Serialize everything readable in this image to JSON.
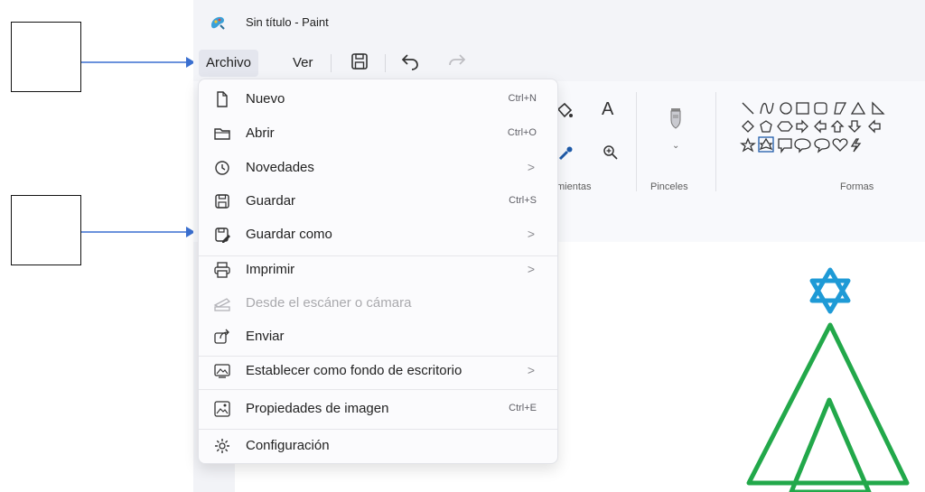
{
  "window": {
    "title": "Sin título - Paint"
  },
  "menubar": {
    "file_label": "Archivo",
    "view_label": "Ver",
    "save_icon": "save-icon",
    "undo_icon": "undo-icon",
    "redo_icon": "redo-icon"
  },
  "ribbon": {
    "tools_label": "mientas",
    "brushes_label": "Pinceles",
    "shapes_label": "Formas"
  },
  "file_menu": {
    "items": [
      {
        "label": "Nuevo",
        "shortcut": "Ctrl+N",
        "icon": "new-file-icon"
      },
      {
        "label": "Abrir",
        "shortcut": "Ctrl+O",
        "icon": "folder-icon"
      },
      {
        "label": "Novedades",
        "submenu": ">",
        "icon": "clock-icon"
      },
      {
        "label": "Guardar",
        "shortcut": "Ctrl+S",
        "icon": "save-icon"
      },
      {
        "label": "Guardar como",
        "submenu": ">",
        "icon": "save-as-icon"
      },
      {
        "label": "Imprimir",
        "submenu": ">",
        "icon": "printer-icon"
      },
      {
        "label": "Desde el escáner o cámara",
        "disabled": true,
        "icon": "scanner-icon"
      },
      {
        "label": "Enviar",
        "icon": "share-icon"
      },
      {
        "label": "Establecer como fondo de escritorio",
        "submenu": ">",
        "icon": "desktop-background-icon"
      },
      {
        "label": "Propiedades de imagen",
        "shortcut": "Ctrl+E",
        "icon": "image-properties-icon"
      },
      {
        "label": "Configuración",
        "icon": "gear-icon"
      }
    ]
  },
  "colors": {
    "accent_blue": "#1e9ad6",
    "tree_green": "#22a84a",
    "arrow_blue": "#3a6fd0"
  }
}
